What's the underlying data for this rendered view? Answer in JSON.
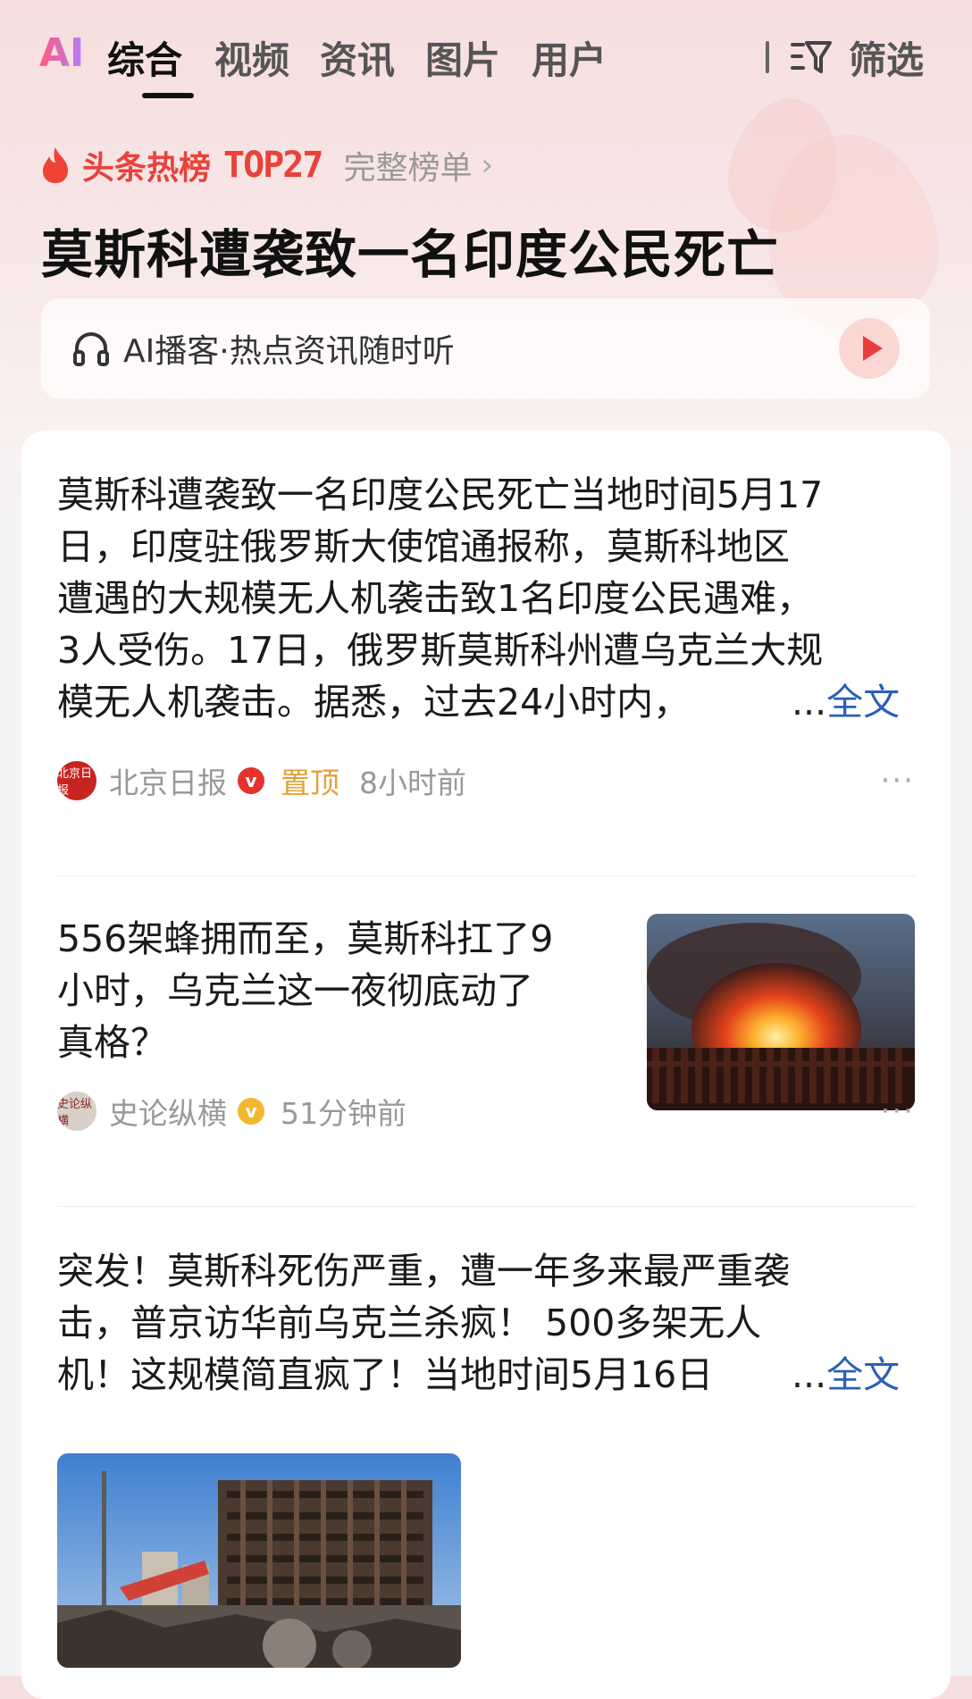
{
  "tabs": {
    "ai_label": "AI",
    "items": [
      "综合",
      "视频",
      "资讯",
      "图片",
      "用户"
    ],
    "active_index": 0,
    "filter_label": "筛选"
  },
  "hot": {
    "title": "头条热榜",
    "rank": "TOP27",
    "full_list": "完整榜单",
    "headline": "莫斯科遭袭致一名印度公民死亡"
  },
  "podcast": {
    "label": "AI播客·热点资讯随时听"
  },
  "feed": [
    {
      "lines": [
        "莫斯科遭袭致一名印度公民死亡当地时间5月17",
        "日，印度驻俄罗斯大使馆通报称，莫斯科地区",
        "遭遇的大规模无人机袭击致1名印度公民遇难，",
        "3人受伤。17日，俄罗斯莫斯科州遭乌克兰大规",
        "模无人机袭击。据悉，过去24小时内，"
      ],
      "ellipsis": "...",
      "full_text": "全文",
      "source": "北京日报",
      "avatar_text": "北京日报",
      "verified_mark": "v",
      "pinned": "置顶",
      "time": "8小时前",
      "more": "···"
    },
    {
      "lines": [
        "556架蜂拥而至，莫斯科扛了9",
        "小时，乌克兰这一夜彻底动了",
        "真格？"
      ],
      "source": "史论纵横",
      "avatar_text": "史论纵横",
      "verified_mark": "v",
      "time": "51分钟前",
      "more": "···"
    },
    {
      "lines": [
        "突发！莫斯科死伤严重，遭一年多来最严重袭",
        "击，普京访华前乌克兰杀疯！ 500多架无人",
        "机！这规模简直疯了！当地时间5月16日"
      ],
      "ellipsis": "...",
      "full_text": "全文"
    }
  ],
  "colors": {
    "accent_red": "#e8423b",
    "link_blue": "#2b5fb8",
    "pin_orange": "#e1a13a",
    "badge_red": "#e5322d",
    "badge_gold": "#f3b72f"
  }
}
